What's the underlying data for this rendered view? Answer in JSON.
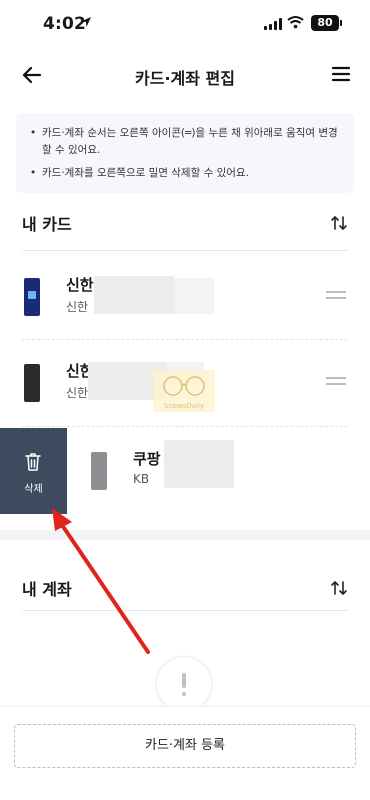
{
  "status_bar": {
    "time": "4:02",
    "battery": "80"
  },
  "header": {
    "title": "카드·계좌 편집"
  },
  "notice": {
    "items": [
      "카드·계좌 순서는 오른쪽 아이콘(═)을 누른 채 위아래로 움직여 변경할 수 있어요.",
      "카드·계좌를 오른쪽으로 밀면 삭제할 수 있어요."
    ]
  },
  "my_cards": {
    "title": "내 카드",
    "items": [
      {
        "name": "신한",
        "sub": "신한",
        "thumb_color": "#1b2a72"
      },
      {
        "name": "신한",
        "sub": "신한",
        "thumb_color": "#2a2a2a"
      },
      {
        "name": "쿠팡",
        "sub": "KB",
        "thumb_color": "#8d8f93"
      }
    ],
    "delete_label": "삭제"
  },
  "watermark": {
    "text": "SnowsDaily"
  },
  "my_accounts": {
    "title": "내 계좌"
  },
  "bottom": {
    "register_label": "카드·계좌 등록"
  },
  "colors": {
    "delete_bg": "#3e4a5e",
    "arrow": "#e0241d"
  }
}
